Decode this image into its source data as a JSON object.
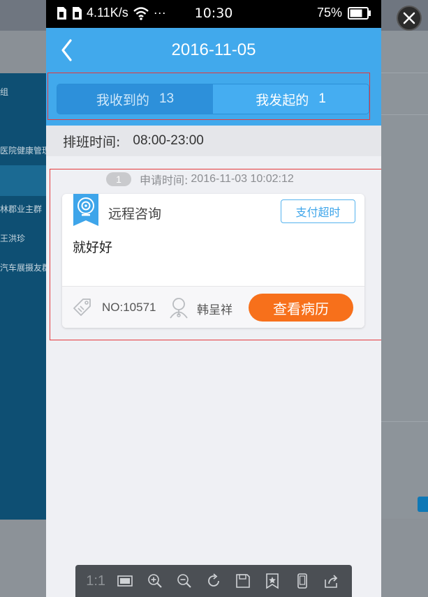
{
  "status_bar": {
    "speed": "4.11K/s",
    "dots": "···",
    "time": "10:30",
    "battery": "75%"
  },
  "header": {
    "title": "2016-11-05"
  },
  "tabs": [
    {
      "label": "我收到的",
      "count": "13",
      "active": false
    },
    {
      "label": "我发起的",
      "count": "1",
      "active": true
    }
  ],
  "shift": {
    "label": "排班时间:",
    "value": "08:00-23:00"
  },
  "record": {
    "index": "1",
    "time_label": "申请时间:",
    "time_value": "2016-11-03 10:02:12",
    "title": "远程咨询",
    "status": "支付超时",
    "content": "就好好",
    "number": "NO:10571",
    "doctor": "韩呈祥",
    "action": "查看病历"
  },
  "background_sidebar": {
    "items": [
      "组",
      "医院健康管理",
      "林郡业主群",
      "王洪珍",
      "汽车展摄友群"
    ]
  },
  "toolbar": {
    "ratio": "1:1",
    "icons": [
      "fit-window-icon",
      "zoom-in-icon",
      "zoom-out-icon",
      "rotate-icon",
      "save-icon",
      "favorite-icon",
      "phone-view-icon",
      "share-icon"
    ]
  },
  "colors": {
    "header": "#41a9ec",
    "accent_orange": "#f7701b",
    "status_blue": "#3ea5ea",
    "highlight_red": "#e5383b"
  }
}
